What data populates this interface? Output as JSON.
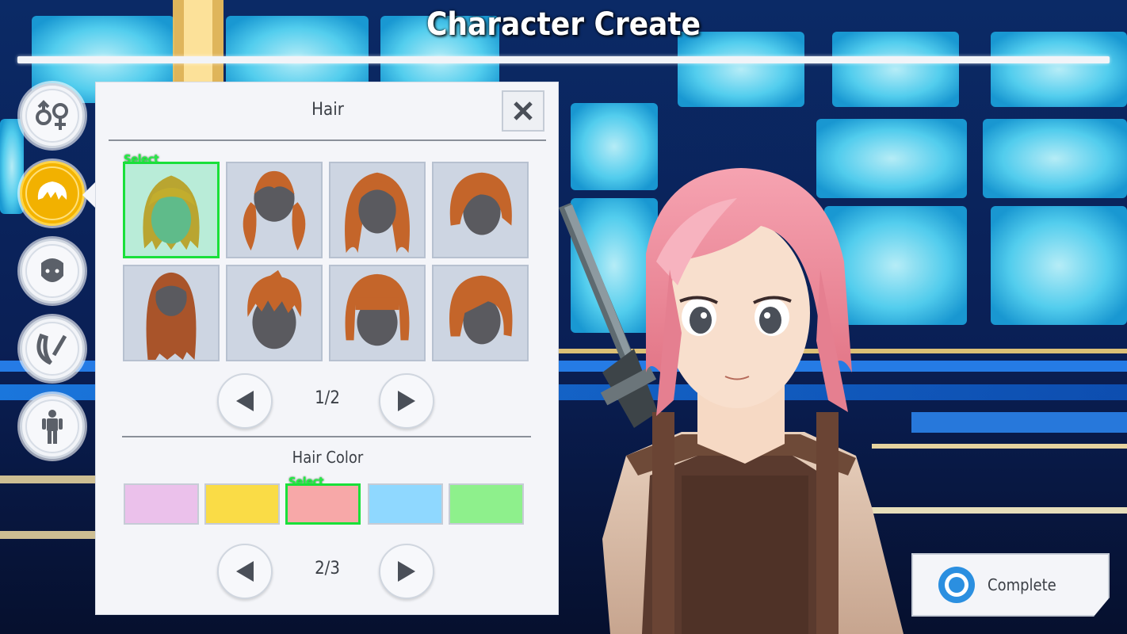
{
  "header": {
    "title": "Character Create"
  },
  "sidebar": {
    "items": [
      {
        "name": "gender",
        "icon": "gender-icon",
        "active": false
      },
      {
        "name": "hair",
        "icon": "hair-icon",
        "active": true
      },
      {
        "name": "face",
        "icon": "face-icon",
        "active": false
      },
      {
        "name": "makeup",
        "icon": "brush-icon",
        "active": false
      },
      {
        "name": "body",
        "icon": "body-icon",
        "active": false
      }
    ]
  },
  "panel": {
    "title": "Hair",
    "close_icon": "close-icon",
    "select_label": "Select",
    "hairstyles": [
      {
        "style": "long-straight",
        "selected": true
      },
      {
        "style": "twin-tails",
        "selected": false
      },
      {
        "style": "long-wavy",
        "selected": false
      },
      {
        "style": "bob-side",
        "selected": false
      },
      {
        "style": "very-long",
        "selected": false
      },
      {
        "style": "short-spiky",
        "selected": false
      },
      {
        "style": "bob-bangs",
        "selected": false
      },
      {
        "style": "short-bob",
        "selected": false
      }
    ],
    "hair_page": "1/2",
    "hair_color_title": "Hair Color",
    "colors": [
      {
        "hex": "#ebc1eb",
        "selected": false
      },
      {
        "hex": "#fadc46",
        "selected": false
      },
      {
        "hex": "#f7a8a8",
        "selected": true
      },
      {
        "hex": "#8fd8ff",
        "selected": false
      },
      {
        "hex": "#8ef08c",
        "selected": false
      }
    ],
    "color_page": "2/3"
  },
  "footer": {
    "complete_label": "Complete"
  },
  "colors": {
    "accent": "#f4b400",
    "select": "#19e03a",
    "hair": "#c4652a",
    "preview_hair": "#f08a9a"
  }
}
